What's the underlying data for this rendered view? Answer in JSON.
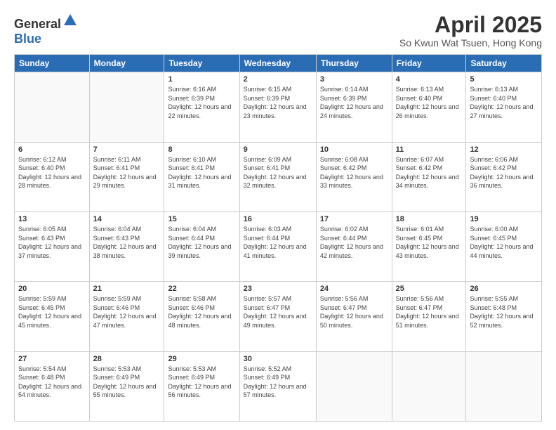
{
  "header": {
    "logo_general": "General",
    "logo_blue": "Blue",
    "title": "April 2025",
    "subtitle": "So Kwun Wat Tsuen, Hong Kong"
  },
  "days_of_week": [
    "Sunday",
    "Monday",
    "Tuesday",
    "Wednesday",
    "Thursday",
    "Friday",
    "Saturday"
  ],
  "weeks": [
    [
      {
        "day": "",
        "info": ""
      },
      {
        "day": "",
        "info": ""
      },
      {
        "day": "1",
        "info": "Sunrise: 6:16 AM\nSunset: 6:39 PM\nDaylight: 12 hours and 22 minutes."
      },
      {
        "day": "2",
        "info": "Sunrise: 6:15 AM\nSunset: 6:39 PM\nDaylight: 12 hours and 23 minutes."
      },
      {
        "day": "3",
        "info": "Sunrise: 6:14 AM\nSunset: 6:39 PM\nDaylight: 12 hours and 24 minutes."
      },
      {
        "day": "4",
        "info": "Sunrise: 6:13 AM\nSunset: 6:40 PM\nDaylight: 12 hours and 26 minutes."
      },
      {
        "day": "5",
        "info": "Sunrise: 6:13 AM\nSunset: 6:40 PM\nDaylight: 12 hours and 27 minutes."
      }
    ],
    [
      {
        "day": "6",
        "info": "Sunrise: 6:12 AM\nSunset: 6:40 PM\nDaylight: 12 hours and 28 minutes."
      },
      {
        "day": "7",
        "info": "Sunrise: 6:11 AM\nSunset: 6:41 PM\nDaylight: 12 hours and 29 minutes."
      },
      {
        "day": "8",
        "info": "Sunrise: 6:10 AM\nSunset: 6:41 PM\nDaylight: 12 hours and 31 minutes."
      },
      {
        "day": "9",
        "info": "Sunrise: 6:09 AM\nSunset: 6:41 PM\nDaylight: 12 hours and 32 minutes."
      },
      {
        "day": "10",
        "info": "Sunrise: 6:08 AM\nSunset: 6:42 PM\nDaylight: 12 hours and 33 minutes."
      },
      {
        "day": "11",
        "info": "Sunrise: 6:07 AM\nSunset: 6:42 PM\nDaylight: 12 hours and 34 minutes."
      },
      {
        "day": "12",
        "info": "Sunrise: 6:06 AM\nSunset: 6:42 PM\nDaylight: 12 hours and 36 minutes."
      }
    ],
    [
      {
        "day": "13",
        "info": "Sunrise: 6:05 AM\nSunset: 6:43 PM\nDaylight: 12 hours and 37 minutes."
      },
      {
        "day": "14",
        "info": "Sunrise: 6:04 AM\nSunset: 6:43 PM\nDaylight: 12 hours and 38 minutes."
      },
      {
        "day": "15",
        "info": "Sunrise: 6:04 AM\nSunset: 6:44 PM\nDaylight: 12 hours and 39 minutes."
      },
      {
        "day": "16",
        "info": "Sunrise: 6:03 AM\nSunset: 6:44 PM\nDaylight: 12 hours and 41 minutes."
      },
      {
        "day": "17",
        "info": "Sunrise: 6:02 AM\nSunset: 6:44 PM\nDaylight: 12 hours and 42 minutes."
      },
      {
        "day": "18",
        "info": "Sunrise: 6:01 AM\nSunset: 6:45 PM\nDaylight: 12 hours and 43 minutes."
      },
      {
        "day": "19",
        "info": "Sunrise: 6:00 AM\nSunset: 6:45 PM\nDaylight: 12 hours and 44 minutes."
      }
    ],
    [
      {
        "day": "20",
        "info": "Sunrise: 5:59 AM\nSunset: 6:45 PM\nDaylight: 12 hours and 45 minutes."
      },
      {
        "day": "21",
        "info": "Sunrise: 5:59 AM\nSunset: 6:46 PM\nDaylight: 12 hours and 47 minutes."
      },
      {
        "day": "22",
        "info": "Sunrise: 5:58 AM\nSunset: 6:46 PM\nDaylight: 12 hours and 48 minutes."
      },
      {
        "day": "23",
        "info": "Sunrise: 5:57 AM\nSunset: 6:47 PM\nDaylight: 12 hours and 49 minutes."
      },
      {
        "day": "24",
        "info": "Sunrise: 5:56 AM\nSunset: 6:47 PM\nDaylight: 12 hours and 50 minutes."
      },
      {
        "day": "25",
        "info": "Sunrise: 5:56 AM\nSunset: 6:47 PM\nDaylight: 12 hours and 51 minutes."
      },
      {
        "day": "26",
        "info": "Sunrise: 5:55 AM\nSunset: 6:48 PM\nDaylight: 12 hours and 52 minutes."
      }
    ],
    [
      {
        "day": "27",
        "info": "Sunrise: 5:54 AM\nSunset: 6:48 PM\nDaylight: 12 hours and 54 minutes."
      },
      {
        "day": "28",
        "info": "Sunrise: 5:53 AM\nSunset: 6:49 PM\nDaylight: 12 hours and 55 minutes."
      },
      {
        "day": "29",
        "info": "Sunrise: 5:53 AM\nSunset: 6:49 PM\nDaylight: 12 hours and 56 minutes."
      },
      {
        "day": "30",
        "info": "Sunrise: 5:52 AM\nSunset: 6:49 PM\nDaylight: 12 hours and 57 minutes."
      },
      {
        "day": "",
        "info": ""
      },
      {
        "day": "",
        "info": ""
      },
      {
        "day": "",
        "info": ""
      }
    ]
  ]
}
